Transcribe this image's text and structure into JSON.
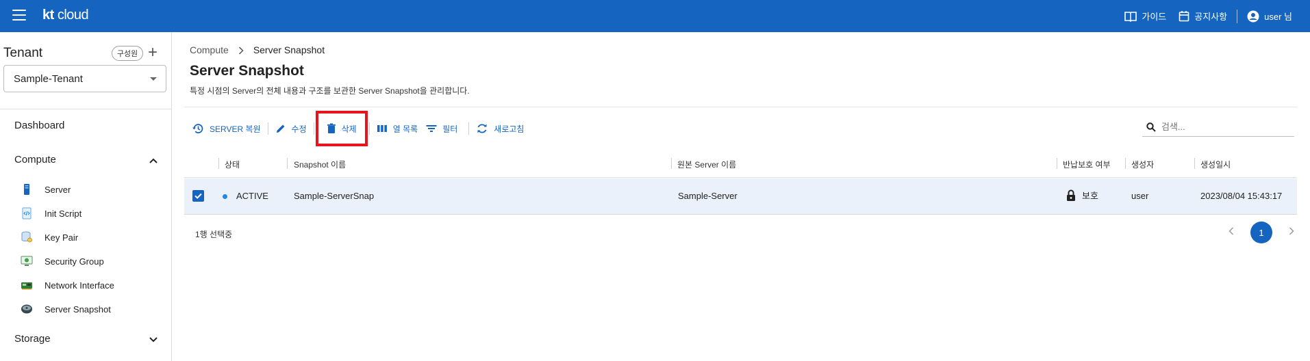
{
  "header": {
    "logo_kt": "kt",
    "logo_cloud": "cloud",
    "guide_label": "가이드",
    "notice_label": "공지사항",
    "user_label": "user 님"
  },
  "sidebar": {
    "tenant_title": "Tenant",
    "member_chip": "구성원",
    "add_symbol": "+",
    "tenant_selected": "Sample-Tenant",
    "dashboard": "Dashboard",
    "compute": "Compute",
    "storage": "Storage",
    "compute_items": [
      {
        "label": "Server",
        "icon": "server-icon"
      },
      {
        "label": "Init Script",
        "icon": "script-icon"
      },
      {
        "label": "Key Pair",
        "icon": "key-pair-icon"
      },
      {
        "label": "Security Group",
        "icon": "security-group-icon"
      },
      {
        "label": "Network Interface",
        "icon": "network-interface-icon"
      },
      {
        "label": "Server Snapshot",
        "icon": "snapshot-icon"
      }
    ]
  },
  "main": {
    "breadcrumb": [
      "Compute",
      "Server Snapshot"
    ],
    "title": "Server Snapshot",
    "description": "특정 시점의 Server의 전체 내용과 구조를 보관한 Server Snapshot을 관리합니다.",
    "toolbar": {
      "restore": "SERVER 복원",
      "edit": "수정",
      "delete": "삭제",
      "columns": "열 목록",
      "filter": "필터",
      "refresh": "새로고침"
    },
    "search_placeholder": "검색...",
    "columns": [
      "상태",
      "Snapshot 이름",
      "원본 Server 이름",
      "반납보호 여부",
      "생성자",
      "생성일시"
    ],
    "rows": [
      {
        "checked": true,
        "status": "ACTIVE",
        "snapshot_name": "Sample-ServerSnap",
        "source_server": "Sample-Server",
        "protection": "보호",
        "creator": "user",
        "created_at": "2023/08/04 15:43:17"
      }
    ],
    "selection_text": "1행 선택중",
    "pagination": {
      "current_page": "1"
    }
  },
  "colors": {
    "brand": "#1565c0",
    "highlight": "#e8141b",
    "row_selected": "#eaf1fb",
    "status_active": "#1e88e5"
  }
}
